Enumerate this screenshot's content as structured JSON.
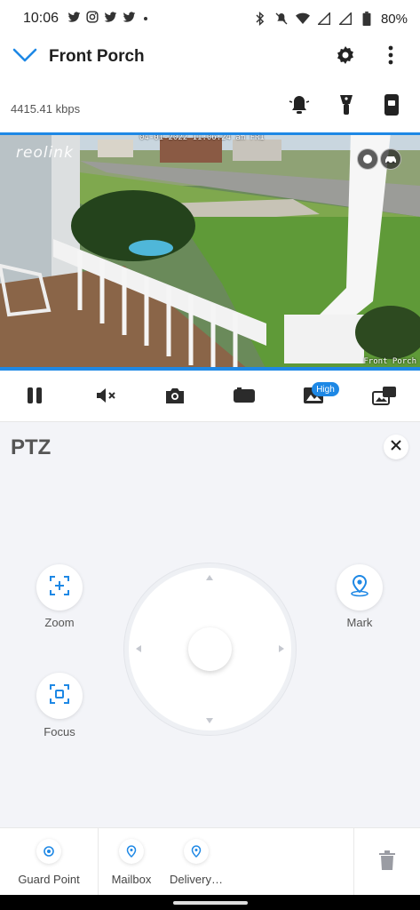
{
  "status_bar": {
    "time": "10:06",
    "battery": "80%",
    "left_icons": [
      "twitter-icon",
      "instagram-icon",
      "twitter-icon",
      "twitter-icon",
      "dot-icon"
    ],
    "right_icons": [
      "bluetooth-icon",
      "mute-icon",
      "wifi-icon",
      "signal-icon",
      "signal-icon",
      "battery-icon"
    ]
  },
  "header": {
    "title": "Front Porch",
    "back_icon": "chevron-down-icon",
    "settings_icon": "gear-icon",
    "more_icon": "more-vertical-icon"
  },
  "info": {
    "bitrate": "4415.41 kbps",
    "icons": [
      "siren-icon",
      "floodlight-icon",
      "phone-icon"
    ]
  },
  "video": {
    "brand": "reolink",
    "timestamp": "04-01-2022 11:06:24 am FRI",
    "camera_name": "Front Porch",
    "badges": [
      "motion-icon",
      "vehicle-icon"
    ]
  },
  "controls": {
    "items": [
      "pause-icon",
      "mute-icon",
      "camera-icon",
      "record-icon",
      "quality-icon",
      "switch-view-icon"
    ],
    "quality_badge": "High"
  },
  "ptz": {
    "title": "PTZ",
    "zoom_label": "Zoom",
    "focus_label": "Focus",
    "mark_label": "Mark"
  },
  "presets": {
    "items": [
      {
        "label": "Guard Point",
        "icon": "target-icon"
      },
      {
        "label": "Mailbox",
        "icon": "location-pin-icon"
      },
      {
        "label": "Delivery…",
        "icon": "location-pin-icon"
      }
    ],
    "delete_icon": "trash-icon"
  },
  "colors": {
    "accent": "#1e88e5",
    "icon_dark": "#2b2b2b",
    "background": "#f3f4f8"
  }
}
